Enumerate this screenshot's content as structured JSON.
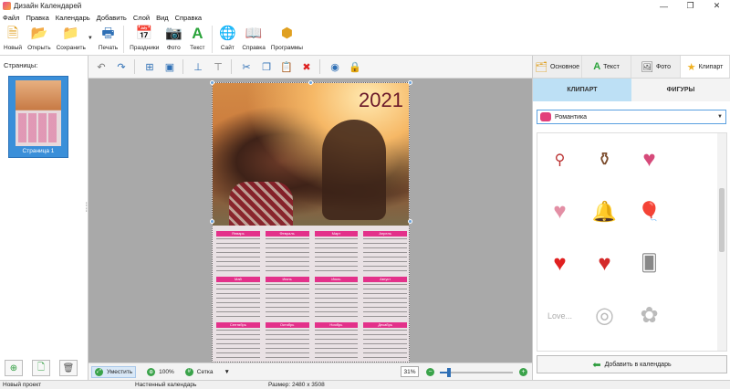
{
  "window": {
    "title": "Дизайн Календарей",
    "minimize": "—",
    "maximize": "❐",
    "close": "✕"
  },
  "menu": [
    "Файл",
    "Правка",
    "Календарь",
    "Добавить",
    "Слой",
    "Вид",
    "Справка"
  ],
  "ribbon": {
    "new": "Новый",
    "open": "Открыть",
    "save": "Сохранить",
    "print": "Печать",
    "holidays": "Праздники",
    "photo": "Фото",
    "text": "Текст",
    "site": "Сайт",
    "help": "Справка",
    "programs": "Программы"
  },
  "pages": {
    "title": "Страницы:",
    "thumb_label": "Страница 1"
  },
  "calendar": {
    "year": "2021",
    "months": [
      "Январь",
      "Февраль",
      "Март",
      "Апрель",
      "Май",
      "Июнь",
      "Июль",
      "Август",
      "Сентябрь",
      "Октябрь",
      "Ноябрь",
      "Декабрь"
    ]
  },
  "zoombar": {
    "fit": "Уместить",
    "zoom100": "100%",
    "grid": "Сетка",
    "zoom_value": "31%",
    "zoom_fraction": 0.12
  },
  "right_panel": {
    "tabs": [
      "Основное",
      "Текст",
      "Фото",
      "Клипарт"
    ],
    "subtabs": [
      "КЛИПАРТ",
      "ФИГУРЫ"
    ],
    "category": "Романтика",
    "add_button": "Добавить в календарь"
  },
  "status": {
    "project": "Новый проект",
    "type": "Настенный календарь",
    "size": "Размер: 2480 x 3508"
  },
  "colors": {
    "accent": "#3a8fd9",
    "month_header": "#e3318a",
    "green": "#3aa34a"
  }
}
